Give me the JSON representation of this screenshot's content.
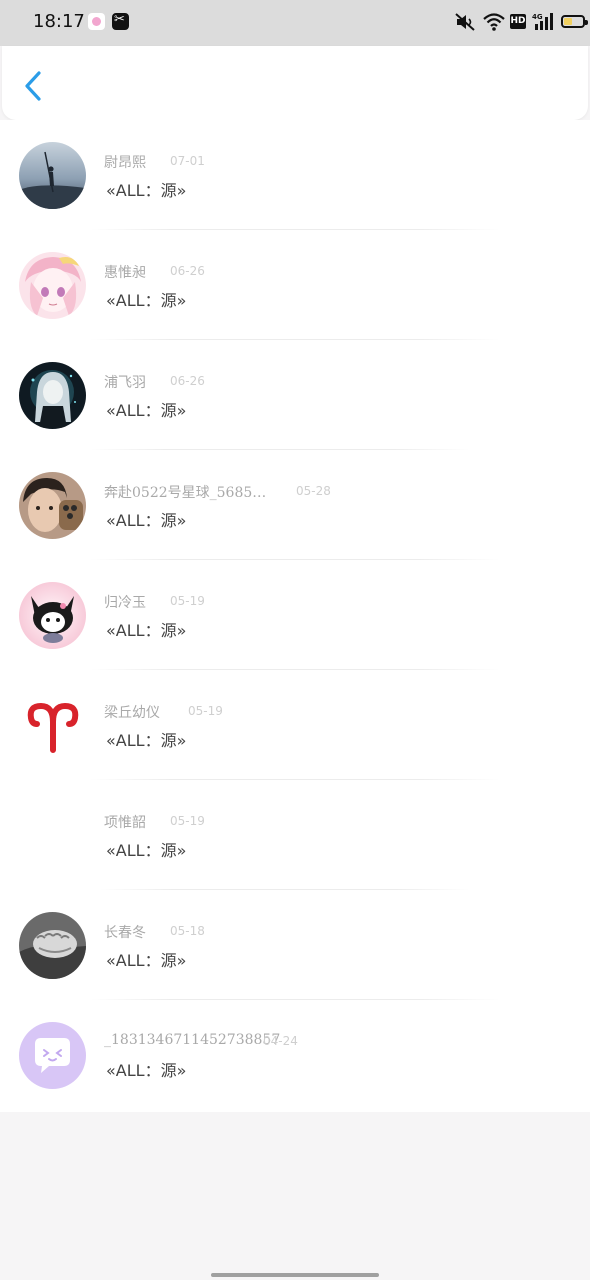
{
  "status_bar": {
    "time": "18:17",
    "network": "4G",
    "hd": "HD"
  },
  "header": {
    "back_icon": "chevron-left-icon",
    "accent": "#2b9de8"
  },
  "messages": [
    {
      "name": "尉昂熙",
      "date": "07-01",
      "text": "«ALL：源»"
    },
    {
      "name": "惠惟昶",
      "date": "06-26",
      "text": "«ALL：源»"
    },
    {
      "name": "浦飞羽",
      "date": "06-26",
      "text": "«ALL：源»"
    },
    {
      "name": "奔赴0522号星球_5685…",
      "date": "05-28",
      "text": "«ALL：源»"
    },
    {
      "name": "归冷玉",
      "date": "05-19",
      "text": "«ALL：源»"
    },
    {
      "name": "梁丘幼仪",
      "date": "05-19",
      "text": "«ALL：源»"
    },
    {
      "name": "项惟韶",
      "date": "05-19",
      "text": "«ALL：源»"
    },
    {
      "name": "长春冬",
      "date": "05-18",
      "text": "«ALL：源»"
    },
    {
      "name": "_1831346711452738857",
      "date": "04-24",
      "text": "«ALL：源»"
    }
  ]
}
